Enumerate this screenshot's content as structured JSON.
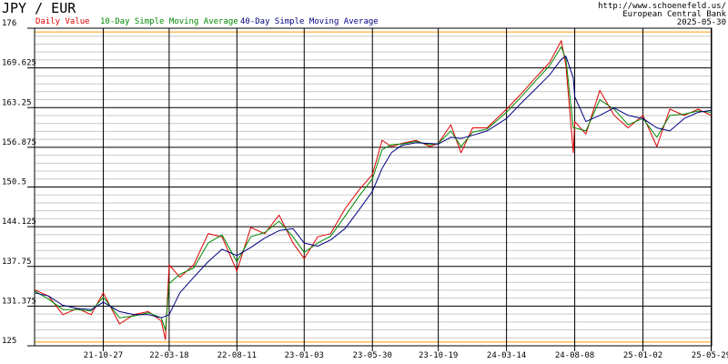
{
  "chart_data": {
    "type": "line",
    "title": "JPY / EUR",
    "source_lines": [
      "http://www.schoenefeld.us/",
      "European Central Bank",
      "2025-05-30"
    ],
    "ylim": [
      125,
      176
    ],
    "y_ticks": [
      "125",
      "131.375",
      "137.75",
      "144.125",
      "150.5",
      "156.875",
      "163.25",
      "169.625",
      "176"
    ],
    "x_ticks": [
      "21-10-27",
      "22-03-18",
      "22-08-11",
      "23-01-03",
      "23-05-30",
      "23-10-19",
      "24-03-14",
      "24-08-08",
      "25-01-02",
      "25-05-29"
    ],
    "grid": true,
    "legend_placement": "top-left",
    "colors": {
      "daily": "#dd0000",
      "sma10": "#008800",
      "sma40": "#000080",
      "reference": "#ff9900",
      "grid": "#000000",
      "minor_grid": "#c8c8c8"
    },
    "series": [
      {
        "name": "Daily Value",
        "key": "daily",
        "x": [
          "21-06-01",
          "21-07-01",
          "21-08-01",
          "21-09-01",
          "21-10-01",
          "21-10-27",
          "21-12-01",
          "22-01-01",
          "22-02-01",
          "22-03-01",
          "22-03-10",
          "22-03-18",
          "22-04-10",
          "22-05-10",
          "22-06-10",
          "22-07-10",
          "22-08-11",
          "22-09-10",
          "22-10-10",
          "22-11-10",
          "22-12-10",
          "23-01-03",
          "23-02-01",
          "23-03-01",
          "23-04-01",
          "23-05-01",
          "23-05-30",
          "23-06-20",
          "23-07-10",
          "23-08-01",
          "23-09-01",
          "23-10-01",
          "23-10-19",
          "23-11-15",
          "23-12-07",
          "24-01-01",
          "24-02-01",
          "24-03-14",
          "24-04-15",
          "24-05-15",
          "24-06-15",
          "24-07-10",
          "24-07-20",
          "24-08-05",
          "24-08-08",
          "24-09-01",
          "24-10-01",
          "24-11-01",
          "24-12-01",
          "25-01-02",
          "25-02-01",
          "25-03-01",
          "25-04-01",
          "25-05-01",
          "25-05-29"
        ],
        "values": [
          134.0,
          133.0,
          130.0,
          131.0,
          130.0,
          133.5,
          128.5,
          130.0,
          130.5,
          129.0,
          126.0,
          138.0,
          136.0,
          138.0,
          143.0,
          142.5,
          137.0,
          144.0,
          143.0,
          146.0,
          141.5,
          139.0,
          142.5,
          143.0,
          147.0,
          150.0,
          152.5,
          158.0,
          157.0,
          157.5,
          158.0,
          157.0,
          157.5,
          160.5,
          156.0,
          160.0,
          160.0,
          163.0,
          165.5,
          168.0,
          170.5,
          174.0,
          170.0,
          156.0,
          161.0,
          159.0,
          166.0,
          162.0,
          160.0,
          162.0,
          157.0,
          163.0,
          162.0,
          163.0,
          162.0
        ]
      },
      {
        "name": "10-Day Simple Moving Average",
        "key": "sma10",
        "x": [
          "21-06-01",
          "21-07-01",
          "21-08-01",
          "21-09-01",
          "21-10-01",
          "21-10-27",
          "21-12-01",
          "22-01-01",
          "22-02-01",
          "22-03-01",
          "22-03-10",
          "22-03-18",
          "22-04-10",
          "22-05-10",
          "22-06-10",
          "22-07-10",
          "22-08-11",
          "22-09-10",
          "22-10-10",
          "22-11-10",
          "22-12-10",
          "23-01-03",
          "23-02-01",
          "23-03-01",
          "23-04-01",
          "23-05-01",
          "23-05-30",
          "23-06-20",
          "23-07-10",
          "23-08-01",
          "23-09-01",
          "23-10-01",
          "23-10-19",
          "23-11-15",
          "23-12-07",
          "24-01-01",
          "24-02-01",
          "24-03-14",
          "24-04-15",
          "24-05-15",
          "24-06-15",
          "24-07-10",
          "24-07-20",
          "24-08-05",
          "24-08-08",
          "24-09-01",
          "24-10-01",
          "24-11-01",
          "24-12-01",
          "25-01-02",
          "25-02-01",
          "25-03-01",
          "25-04-01",
          "25-05-01",
          "25-05-29"
        ],
        "values": [
          133.8,
          132.5,
          130.8,
          130.8,
          130.6,
          132.8,
          129.5,
          129.8,
          130.3,
          129.5,
          127.5,
          135.0,
          136.5,
          137.5,
          141.5,
          142.8,
          138.5,
          142.5,
          143.2,
          145.0,
          142.5,
          140.0,
          141.5,
          142.6,
          145.8,
          149.0,
          151.8,
          156.5,
          157.3,
          157.4,
          157.8,
          157.3,
          157.5,
          159.5,
          157.0,
          159.3,
          159.8,
          162.5,
          165.0,
          167.5,
          170.0,
          173.0,
          171.0,
          160.0,
          160.0,
          159.5,
          164.5,
          163.0,
          160.5,
          161.5,
          158.5,
          162.0,
          162.2,
          162.7,
          162.5
        ]
      },
      {
        "name": "40-Day Simple Moving Average",
        "key": "sma40",
        "x": [
          "21-06-01",
          "21-07-01",
          "21-08-01",
          "21-09-01",
          "21-10-01",
          "21-10-27",
          "21-12-01",
          "22-01-01",
          "22-02-01",
          "22-03-01",
          "22-03-18",
          "22-04-10",
          "22-05-10",
          "22-06-10",
          "22-07-10",
          "22-08-11",
          "22-09-10",
          "22-10-10",
          "22-11-10",
          "22-12-10",
          "23-01-03",
          "23-02-01",
          "23-03-01",
          "23-04-01",
          "23-05-01",
          "23-05-30",
          "23-06-20",
          "23-07-10",
          "23-08-01",
          "23-09-01",
          "23-10-01",
          "23-10-19",
          "23-11-15",
          "23-12-07",
          "24-01-01",
          "24-02-01",
          "24-03-14",
          "24-04-15",
          "24-05-15",
          "24-06-15",
          "24-07-10",
          "24-07-20",
          "24-08-05",
          "24-08-08",
          "24-09-01",
          "24-10-01",
          "24-11-01",
          "24-12-01",
          "25-01-02",
          "25-02-01",
          "25-03-01",
          "25-04-01",
          "25-05-01",
          "25-05-29"
        ],
        "values": [
          133.5,
          133.0,
          131.5,
          131.0,
          130.8,
          132.0,
          130.5,
          130.0,
          130.0,
          129.5,
          130.0,
          133.5,
          136.0,
          138.5,
          140.5,
          139.5,
          140.8,
          142.3,
          143.5,
          143.8,
          141.5,
          141.0,
          142.0,
          143.8,
          146.8,
          149.8,
          153.5,
          156.0,
          157.2,
          157.6,
          157.5,
          157.4,
          158.5,
          158.3,
          158.8,
          159.5,
          161.5,
          164.0,
          166.2,
          168.5,
          171.0,
          171.5,
          168.0,
          165.0,
          161.0,
          162.0,
          163.2,
          162.0,
          161.5,
          160.0,
          159.5,
          161.5,
          162.5,
          162.8
        ]
      }
    ]
  }
}
